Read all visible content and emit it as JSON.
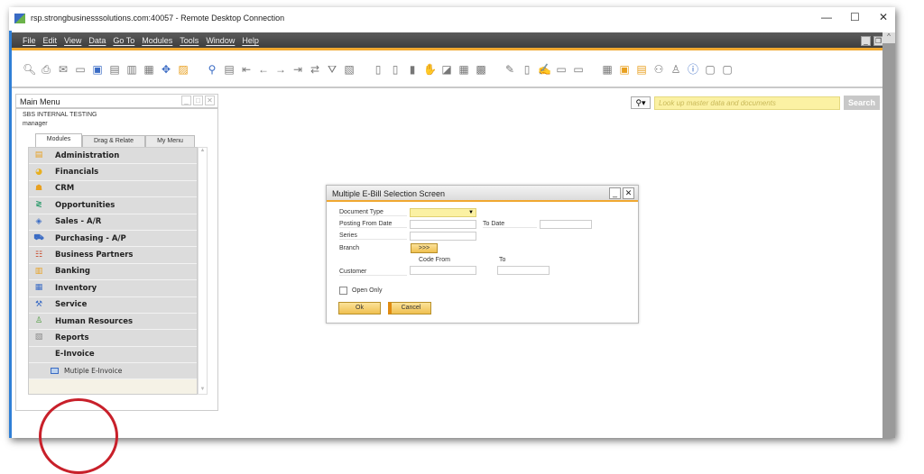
{
  "window": {
    "title": "rsp.strongbusinesssolutions.com:40057 - Remote Desktop Connection",
    "controls": [
      "—",
      "☐",
      "✕"
    ]
  },
  "menubar": [
    "File",
    "Edit",
    "View",
    "Data",
    "Go To",
    "Modules",
    "Tools",
    "Window",
    "Help"
  ],
  "toolbar_icons": [
    "preview-icon",
    "print-icon",
    "email-icon",
    "export-icon",
    "fax-icon",
    "excel-icon",
    "word-icon",
    "pdf-icon",
    "launch-icon",
    "lock-icon",
    "find-icon",
    "add-icon",
    "first-icon",
    "prev-icon",
    "next-icon",
    "last-icon",
    "refresh-icon",
    "filter-icon",
    "sort-icon"
  ],
  "search": {
    "placeholder": "Look up master data and documents",
    "button": "Search"
  },
  "main_menu": {
    "title": "Main Menu",
    "company": "SBS INTERNAL TESTING",
    "user": "manager",
    "tabs": [
      "Modules",
      "Drag & Relate",
      "My Menu"
    ],
    "items": [
      {
        "label": "Administration",
        "icon": "administration-icon",
        "glyph": "▤",
        "color": "#e8a020"
      },
      {
        "label": "Financials",
        "icon": "financials-pie-icon",
        "glyph": "◕",
        "color": "#e8b020"
      },
      {
        "label": "CRM",
        "icon": "crm-people-icon",
        "glyph": "☗",
        "color": "#e8a020"
      },
      {
        "label": "Opportunities",
        "icon": "opportunities-icon",
        "glyph": "≷",
        "color": "#2a9a6a"
      },
      {
        "label": "Sales - A/R",
        "icon": "sales-tag-icon",
        "glyph": "◈",
        "color": "#3a6bc4"
      },
      {
        "label": "Purchasing - A/P",
        "icon": "cart-icon",
        "glyph": "⛟",
        "color": "#3a6bc4"
      },
      {
        "label": "Business Partners",
        "icon": "business-partners-icon",
        "glyph": "☷",
        "color": "#c84a2a"
      },
      {
        "label": "Banking",
        "icon": "banking-icon",
        "glyph": "▥",
        "color": "#e8a020"
      },
      {
        "label": "Inventory",
        "icon": "inventory-icon",
        "glyph": "▦",
        "color": "#3a6bc4"
      },
      {
        "label": "Service",
        "icon": "service-wrench-icon",
        "glyph": "⚒",
        "color": "#3a6bc4"
      },
      {
        "label": "Human Resources",
        "icon": "human-resources-icon",
        "glyph": "♙",
        "color": "#4a9a3a"
      },
      {
        "label": "Reports",
        "icon": "reports-icon",
        "glyph": "▧",
        "color": "#888"
      },
      {
        "label": "E-Invoice",
        "icon": "",
        "glyph": "",
        "color": "#222"
      }
    ],
    "subitem": "Mutiple E-Invoice",
    "highlight_color": "#c8202a"
  },
  "dialog": {
    "title": "Multiple E-Bill Selection Screen",
    "document_type": "Document Type",
    "posting_from": "Posting From Date",
    "to_date": "To Date",
    "series": "Series",
    "branch": "Branch",
    "branch_button": ">>>",
    "code_from": "Code From",
    "to": "To",
    "customer": "Customer",
    "open_only": "Open Only",
    "ok": "Ok",
    "cancel": "Cancel",
    "dropdown_arrow": "▼"
  },
  "colors": {
    "accent": "#f0a830",
    "menubar": "#4a4a4a",
    "field_yellow": "#fbf1a3"
  }
}
